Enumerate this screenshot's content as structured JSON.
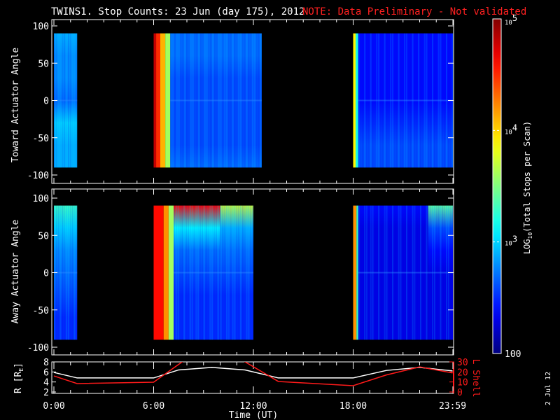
{
  "title": "TWINS1. Stop Counts: 23 Jun (day 175), 2012",
  "note": "NOTE: Data Preliminary - Not validated",
  "date_stamp": "2 Jul 12",
  "colors": {
    "note": "#ff2020",
    "lshell": "#ff1a1a",
    "r_line": "#ffffff",
    "frame": "#ffffff"
  },
  "chart_data": [
    {
      "type": "heatmap",
      "panel": "top",
      "ylabel": "Toward Actuator Angle",
      "yticks": [
        "100",
        "50",
        "0",
        "-50",
        "-100"
      ],
      "ylim": [
        -100,
        100
      ],
      "xlim": [
        0,
        24
      ],
      "angles": [
        90,
        60,
        30,
        0,
        -30,
        -60,
        -90
      ],
      "segments": [
        {
          "t": [
            0,
            1.4
          ],
          "log": [
            2.9,
            2.8,
            2.8,
            2.7,
            3.0,
            2.9,
            2.9
          ]
        },
        {
          "t": [
            6.0,
            6.15
          ],
          "log": [
            4.8,
            4.8,
            4.8,
            4.8,
            4.8,
            4.8,
            4.8
          ]
        },
        {
          "t": [
            6.15,
            6.4
          ],
          "log": [
            4.5,
            4.5,
            4.5,
            4.5,
            4.5,
            4.5,
            4.5
          ]
        },
        {
          "t": [
            6.4,
            6.7
          ],
          "log": [
            4.1,
            4.1,
            4.1,
            4.1,
            4.1,
            4.1,
            4.1
          ]
        },
        {
          "t": [
            6.7,
            7.0
          ],
          "log": [
            3.6,
            3.6,
            3.6,
            3.6,
            3.6,
            3.6,
            3.6
          ]
        },
        {
          "t": [
            7.0,
            12.5
          ],
          "log": [
            2.7,
            2.7,
            2.6,
            2.6,
            2.6,
            2.6,
            2.7
          ]
        },
        {
          "t": [
            18.0,
            18.15
          ],
          "log": [
            3.9,
            3.9,
            3.9,
            3.9,
            3.9,
            3.9,
            3.9
          ]
        },
        {
          "t": [
            18.15,
            18.3
          ],
          "log": [
            3.2,
            3.2,
            3.2,
            3.2,
            3.2,
            3.2,
            3.2
          ]
        },
        {
          "t": [
            18.3,
            24
          ],
          "log": [
            2.4,
            2.4,
            2.4,
            2.4,
            2.5,
            2.6,
            2.6
          ]
        }
      ]
    },
    {
      "type": "heatmap",
      "panel": "bottom",
      "ylabel": "Away Actuator Angle",
      "yticks": [
        "100",
        "50",
        "0",
        "-50",
        "-100"
      ],
      "ylim": [
        -100,
        100
      ],
      "xlim": [
        0,
        24
      ],
      "angles": [
        90,
        60,
        30,
        0,
        -30,
        -60,
        -90
      ],
      "segments": [
        {
          "t": [
            0,
            1.4
          ],
          "log": [
            3.3,
            3.0,
            2.8,
            2.7,
            2.6,
            2.5,
            2.5
          ]
        },
        {
          "t": [
            6.0,
            6.6
          ],
          "log": [
            4.6,
            4.6,
            4.6,
            4.6,
            4.6,
            4.6,
            4.6
          ]
        },
        {
          "t": [
            6.6,
            6.9
          ],
          "log": [
            4.2,
            4.2,
            4.2,
            4.2,
            4.2,
            4.2,
            4.2
          ]
        },
        {
          "t": [
            6.9,
            7.2
          ],
          "log": [
            3.6,
            3.6,
            3.6,
            3.6,
            3.6,
            3.6,
            3.6
          ]
        },
        {
          "t": [
            7.2,
            10.0
          ],
          "log": [
            4.6,
            3.1,
            2.7,
            2.6,
            2.5,
            2.5,
            2.5
          ]
        },
        {
          "t": [
            10.0,
            12.0
          ],
          "log": [
            3.7,
            2.9,
            2.7,
            2.6,
            2.5,
            2.5,
            2.5
          ]
        },
        {
          "t": [
            18.0,
            18.2
          ],
          "log": [
            4.2,
            4.2,
            4.2,
            4.2,
            4.2,
            4.2,
            4.2
          ]
        },
        {
          "t": [
            18.2,
            18.3
          ],
          "log": [
            3.3,
            3.3,
            3.3,
            3.3,
            3.3,
            3.3,
            3.3
          ]
        },
        {
          "t": [
            18.3,
            22.5
          ],
          "log": [
            2.4,
            2.3,
            2.3,
            2.3,
            2.3,
            2.3,
            2.3
          ]
        },
        {
          "t": [
            22.5,
            24
          ],
          "log": [
            3.4,
            2.6,
            2.4,
            2.3,
            2.3,
            2.3,
            2.3
          ]
        }
      ]
    },
    {
      "type": "line",
      "panel": "orbit",
      "xlabel": "Time (UT)",
      "xticks": [
        "0:00",
        "6:00",
        "12:00",
        "18:00",
        "23:59"
      ],
      "xtick_values": [
        0,
        6,
        12,
        18,
        23.98
      ],
      "ylabel_left": "R [R",
      "ylabel_left_sub": "E",
      "ylabel_left_end": "]",
      "ylabel_right": "L Shell",
      "yticks_left": [
        "8",
        "6",
        "4",
        "2"
      ],
      "yticks_right": [
        "30",
        "20",
        "10",
        "0"
      ],
      "ylim_left": [
        2,
        8
      ],
      "ylim_right": [
        0,
        30
      ],
      "series": [
        {
          "name": "R",
          "x": [
            0,
            1.4,
            6.0,
            7.5,
            9.5,
            11.5,
            13.5,
            18.0,
            20.0,
            22.0,
            23.98
          ],
          "y": [
            5.9,
            4.8,
            4.8,
            6.4,
            6.9,
            6.4,
            4.8,
            4.8,
            6.3,
            6.9,
            6.2
          ]
        },
        {
          "name": "L Shell",
          "x": [
            0,
            1.4,
            6.0,
            7.8,
            11.4,
            13.5,
            18.0,
            20.0,
            22.0,
            23.98
          ],
          "y": [
            16,
            8.4,
            9.8,
            31,
            31,
            10.5,
            6.3,
            17,
            25,
            19
          ]
        }
      ]
    },
    {
      "type": "colorbar",
      "label": "LOG",
      "label_sub": "10",
      "label_end": "(Total Stops per Scan)",
      "ticks": [
        {
          "log": 5,
          "base": "10",
          "exp": "5"
        },
        {
          "log": 4,
          "base": "10",
          "exp": "4"
        },
        {
          "log": 3,
          "base": "10",
          "exp": "3"
        },
        {
          "log": 2,
          "text": "100"
        }
      ],
      "range_log": [
        2,
        5
      ]
    }
  ]
}
